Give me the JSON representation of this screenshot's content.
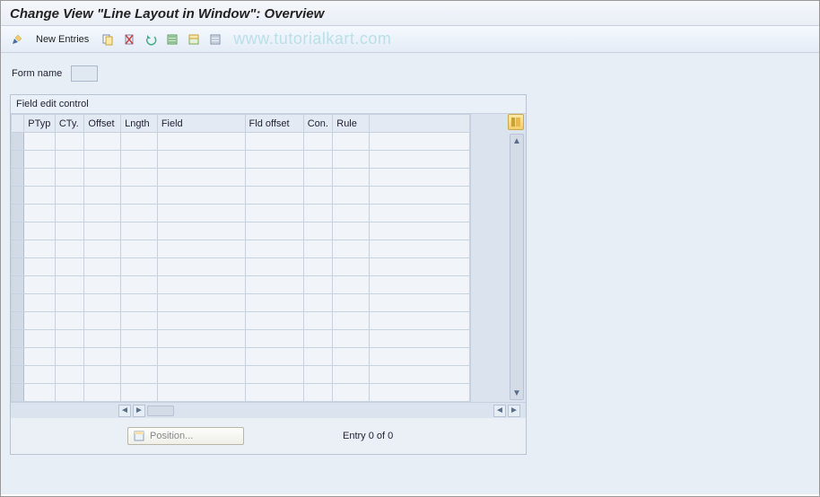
{
  "title": "Change View \"Line Layout in Window\": Overview",
  "toolbar": {
    "new_entries": "New Entries"
  },
  "watermark": "www.tutorialkart.com",
  "form": {
    "name_label": "Form name",
    "name_value": ""
  },
  "panel": {
    "title": "Field edit control",
    "columns": {
      "ptyp": "PTyp",
      "cty": "CTy.",
      "offset": "Offset",
      "length": "Lngth",
      "field": "Field",
      "fld_offset": "Fld offset",
      "con": "Con.",
      "rule": "Rule"
    },
    "row_count": 15
  },
  "footer": {
    "position_label": "Position...",
    "entry_text": "Entry 0 of 0"
  }
}
